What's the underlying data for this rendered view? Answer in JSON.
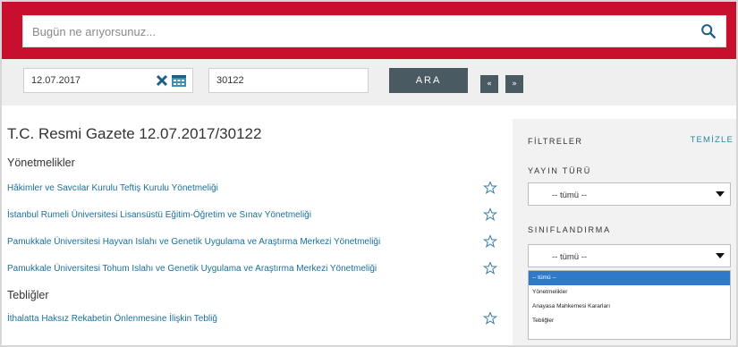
{
  "search": {
    "placeholder": "Bugün ne arıyorsunuz..."
  },
  "filter_bar": {
    "date_value": "12.07.2017",
    "issue_value": "30122",
    "search_button": "ARA",
    "prev_label": "«",
    "next_label": "»"
  },
  "main": {
    "title": "T.C. Resmi Gazete 12.07.2017/30122",
    "sections": [
      {
        "heading": "Yönetmelikler",
        "items": [
          "Hâkimler ve Savcılar Kurulu Teftiş Kurulu Yönetmeliği",
          "İstanbul Rumeli Üniversitesi Lisansüstü Eğitim-Öğretim ve Sınav Yönetmeliği",
          "Pamukkale Üniversitesi Hayvan Islahı ve Genetik Uygulama ve Araştırma Merkezi Yönetmeliği",
          "Pamukkale Üniversitesi Tohum Islahı ve Genetik Uygulama ve Araştırma Merkezi Yönetmeliği"
        ]
      },
      {
        "heading": "Tebliğler",
        "items": [
          "İthalatta Haksız Rekabetin Önlenmesine İlişkin Tebliğ"
        ]
      }
    ]
  },
  "sidebar": {
    "filters_title": "FİLTRELER",
    "clear_label": "TEMİZLE",
    "publication_type_label": "YAYIN TÜRÜ",
    "publication_type_value": "-- tümü --",
    "classification_label": "SINIFLANDIRMA",
    "classification_value": "-- tümü --",
    "classification_options": [
      "-- tümü --",
      "Yönetmelikler",
      "Anayasa Mahkemesi Kararları",
      "Tebliğler"
    ]
  },
  "colors": {
    "brand_red": "#c8102e",
    "button_dark": "#4a5a63",
    "link_blue": "#1b6f99",
    "selection_blue": "#2f79c8"
  }
}
